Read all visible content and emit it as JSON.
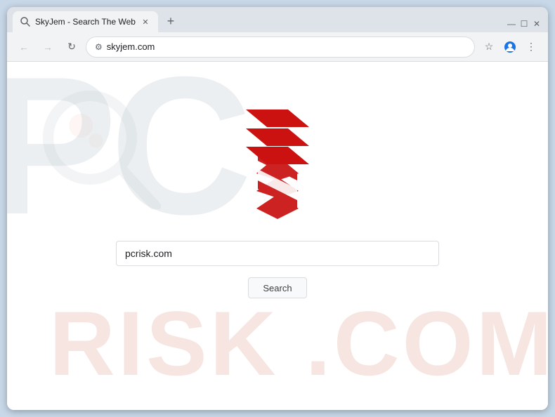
{
  "browser": {
    "tab_title": "SkyJem - Search The Web",
    "url": "skyjem.com",
    "new_tab_icon": "+",
    "minimize_icon": "—",
    "maximize_icon": "☐",
    "close_icon": "✕"
  },
  "toolbar": {
    "back_label": "←",
    "forward_label": "→",
    "refresh_label": "↻",
    "address": "skyjem.com",
    "star_icon": "☆",
    "profile_icon": "👤",
    "menu_icon": "⋮"
  },
  "page": {
    "watermark_pc": "PC",
    "watermark_risk": "RISK",
    "watermark_com": ".COM",
    "search_input_value": "pcrisk.com",
    "search_input_placeholder": "pcrisk.com",
    "search_button_label": "Search"
  }
}
